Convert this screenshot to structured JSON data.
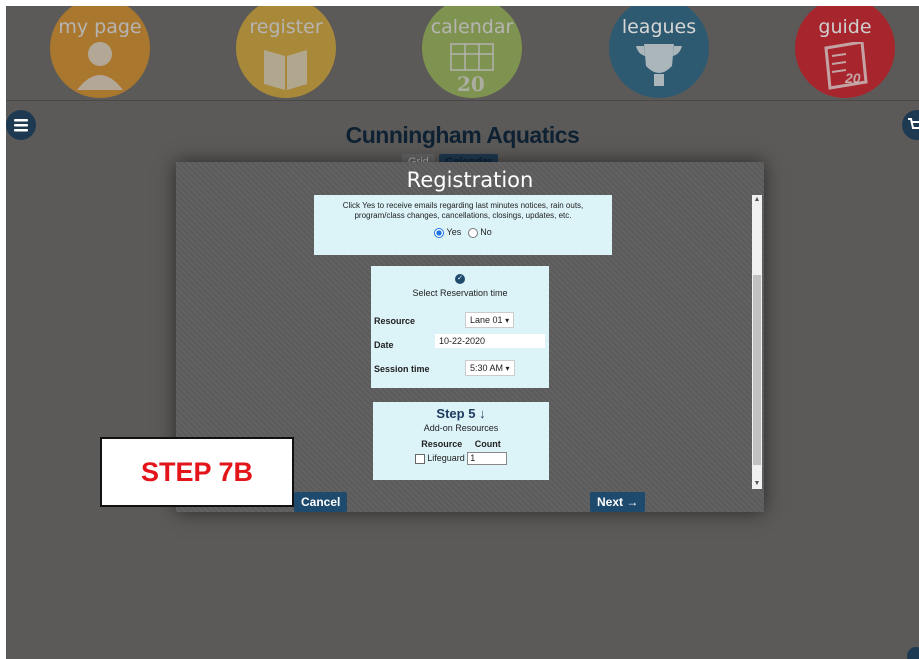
{
  "nav": {
    "my_page": "my page",
    "register": "register",
    "calendar": "calendar",
    "calendar_day": "20",
    "leagues": "leagues",
    "guide": "guide",
    "guide_sub": "20"
  },
  "site": {
    "title": "Cunningham Aquatics"
  },
  "view_tabs": {
    "grid": "Grid",
    "calendar": "Calendar"
  },
  "modal": {
    "title": "Registration",
    "notice_text": "Click Yes to receive emails regarding last minutes notices, rain outs, program/class changes, cancellations, closings, updates, etc.",
    "yes_label": "Yes",
    "no_label": "No",
    "reservation": {
      "heading": "Select Reservation time",
      "resource_label": "Resource",
      "resource_value": "Lane 01",
      "date_label": "Date",
      "date_value": "10-22-2020",
      "session_label": "Session time",
      "session_value": "5:30 AM"
    },
    "step": {
      "title": "Step 5",
      "subtitle": "Add-on Resources",
      "col_resource": "Resource",
      "col_count": "Count",
      "item_label": "Lifeguard",
      "item_count": "1"
    },
    "cancel": "Cancel",
    "next": "Next"
  },
  "callout": {
    "text": "STEP 7B"
  }
}
